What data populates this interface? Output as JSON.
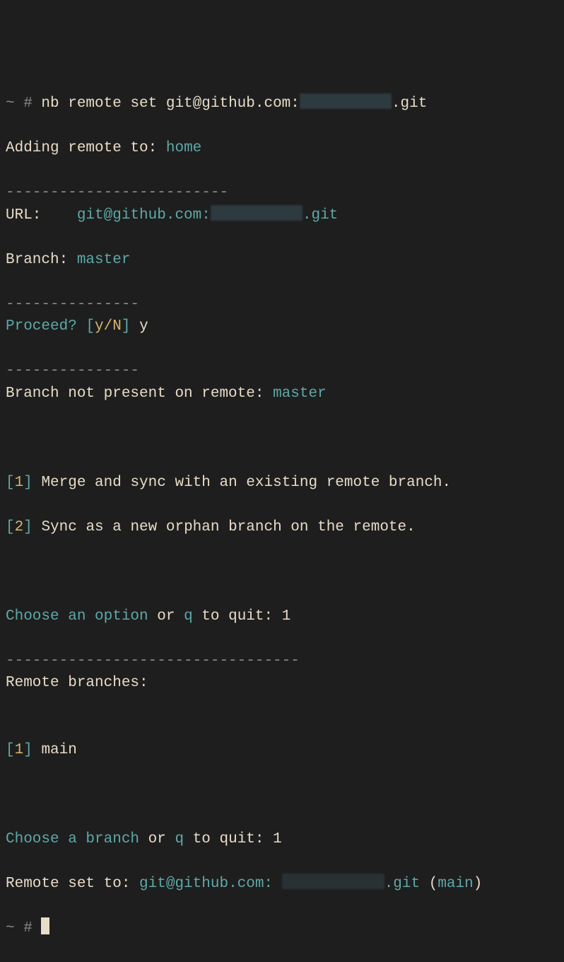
{
  "cmd": {
    "prompt": "~ #",
    "command": "nb remote set git@github.com:",
    "suffix": ".git"
  },
  "adding": {
    "label": "Adding remote to:",
    "value": "home"
  },
  "hr1": "-------------------------",
  "url": {
    "label": "URL:   ",
    "prefix": "git@github.com:",
    "suffix": ".git"
  },
  "branch": {
    "label": "Branch:",
    "value": "master"
  },
  "hr2": "---------------",
  "proceed": {
    "label": "Proceed?",
    "lb": "[",
    "opts": "y/N",
    "rb": "]",
    "answer": "y"
  },
  "hr3": "---------------",
  "notpresent": {
    "label": "Branch not present on remote:",
    "value": "master"
  },
  "optlist": [
    {
      "n": "1",
      "text": "Merge and sync with an existing remote branch."
    },
    {
      "n": "2",
      "text": "Sync as a new orphan branch on the remote."
    }
  ],
  "choose1": {
    "label": "Choose an option",
    "or": "or",
    "q": "q",
    "rest": "to quit:",
    "answer": "1"
  },
  "hr4": "---------------------------------",
  "remotes": {
    "label": "Remote branches:",
    "items": [
      {
        "n": "1",
        "text": "main"
      }
    ]
  },
  "choose2": {
    "label": "Choose a branch",
    "or": "or",
    "q": "q",
    "rest": "to quit:",
    "answer": "1"
  },
  "setto": {
    "label": "Remote set to:",
    "prefix": "git@github.com:",
    "suffix": ".git",
    "branch": "main"
  },
  "prompt2": "~ #"
}
